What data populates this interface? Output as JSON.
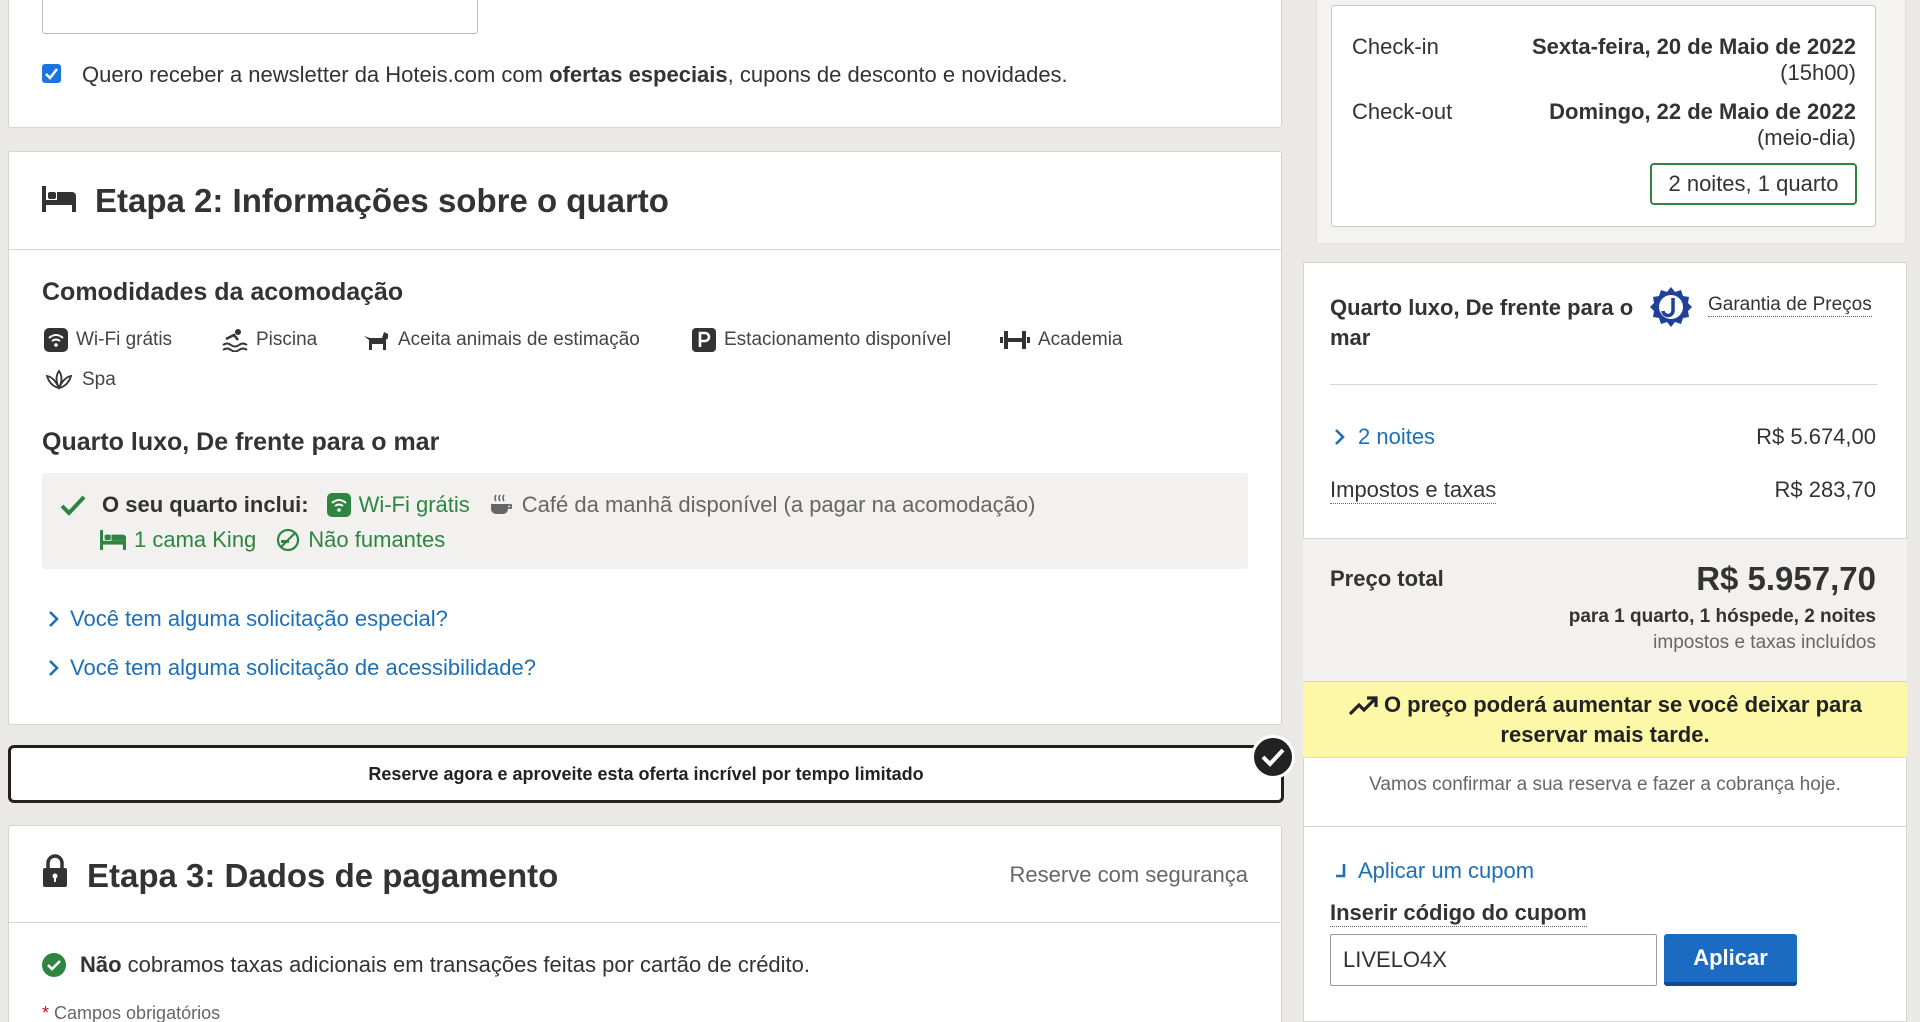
{
  "newsletter": {
    "checked": true,
    "text_before": "Quero receber a newsletter da Hoteis.com com ",
    "text_bold": "ofertas especiais",
    "text_after": ", cupons de desconto e novidades."
  },
  "step2": {
    "title": "Etapa 2: Informações sobre o quarto",
    "amenities_heading": "Comodidades da acomodação",
    "amenities": [
      {
        "label": "Wi-Fi grátis",
        "icon": "wifi-icon"
      },
      {
        "label": "Piscina",
        "icon": "pool-icon"
      },
      {
        "label": "Aceita animais de estimação",
        "icon": "pet-icon"
      },
      {
        "label": "Estacionamento disponível",
        "icon": "parking-icon"
      },
      {
        "label": "Academia",
        "icon": "gym-icon"
      },
      {
        "label": "Spa",
        "icon": "spa-icon"
      }
    ],
    "room_heading": "Quarto luxo, De frente para o mar",
    "includes_label": "O seu quarto inclui:",
    "includes": {
      "wifi": "Wi-Fi grátis",
      "breakfast": "Café da manhã disponível (a pagar na acomodação)",
      "bed": "1 cama King",
      "smoking": "Não fumantes"
    },
    "special_request": "Você tem alguma solicitação especial?",
    "accessibility_request": "Você tem alguma solicitação de acessibilidade?"
  },
  "offer_banner": "Reserve agora e aproveite esta oferta incrível por tempo limitado",
  "step3": {
    "title": "Etapa 3: Dados de pagamento",
    "secure": "Reserve com segurança",
    "no_fees_bold": "Não",
    "no_fees_rest": " cobramos taxas adicionais em transações feitas por cartão de crédito.",
    "required_mark": "*",
    "required_text": " Campos obrigatórios"
  },
  "dates": {
    "checkin_label": "Check-in",
    "checkin_date": "Sexta-feira, 20 de Maio de 2022",
    "checkin_time": "(15h00)",
    "checkout_label": "Check-out",
    "checkout_date": "Domingo, 22 de Maio de 2022",
    "checkout_time": "(meio-dia)",
    "nights_rooms": "2 noites, 1 quarto"
  },
  "summary": {
    "room": "Quarto luxo, De frente para o mar",
    "price_guarantee": "Garantia de Preços",
    "nights_label": "2 noites",
    "nights_value": "R$ 5.674,00",
    "taxes_label": "Impostos e taxas",
    "taxes_value": "R$ 283,70",
    "total_label": "Preço total",
    "total_value": "R$ 5.957,70",
    "total_sub1": "para 1 quarto, 1 hóspede, 2 noites",
    "total_sub2": "impostos e taxas incluídos",
    "alert": "O preço poderá aumentar se você deixar para reservar mais tarde.",
    "confirm": "Vamos confirmar a sua reserva e fazer a cobrança hoje."
  },
  "coupon": {
    "link": "Aplicar um cupom",
    "label": "Inserir código do cupom",
    "value": "LIVELO4X",
    "button": "Aplicar"
  },
  "colors": {
    "link": "#1d6fb8",
    "green": "#2e8540",
    "primary_button": "#1c6bc2",
    "alert_bg": "#fdf8a8"
  }
}
